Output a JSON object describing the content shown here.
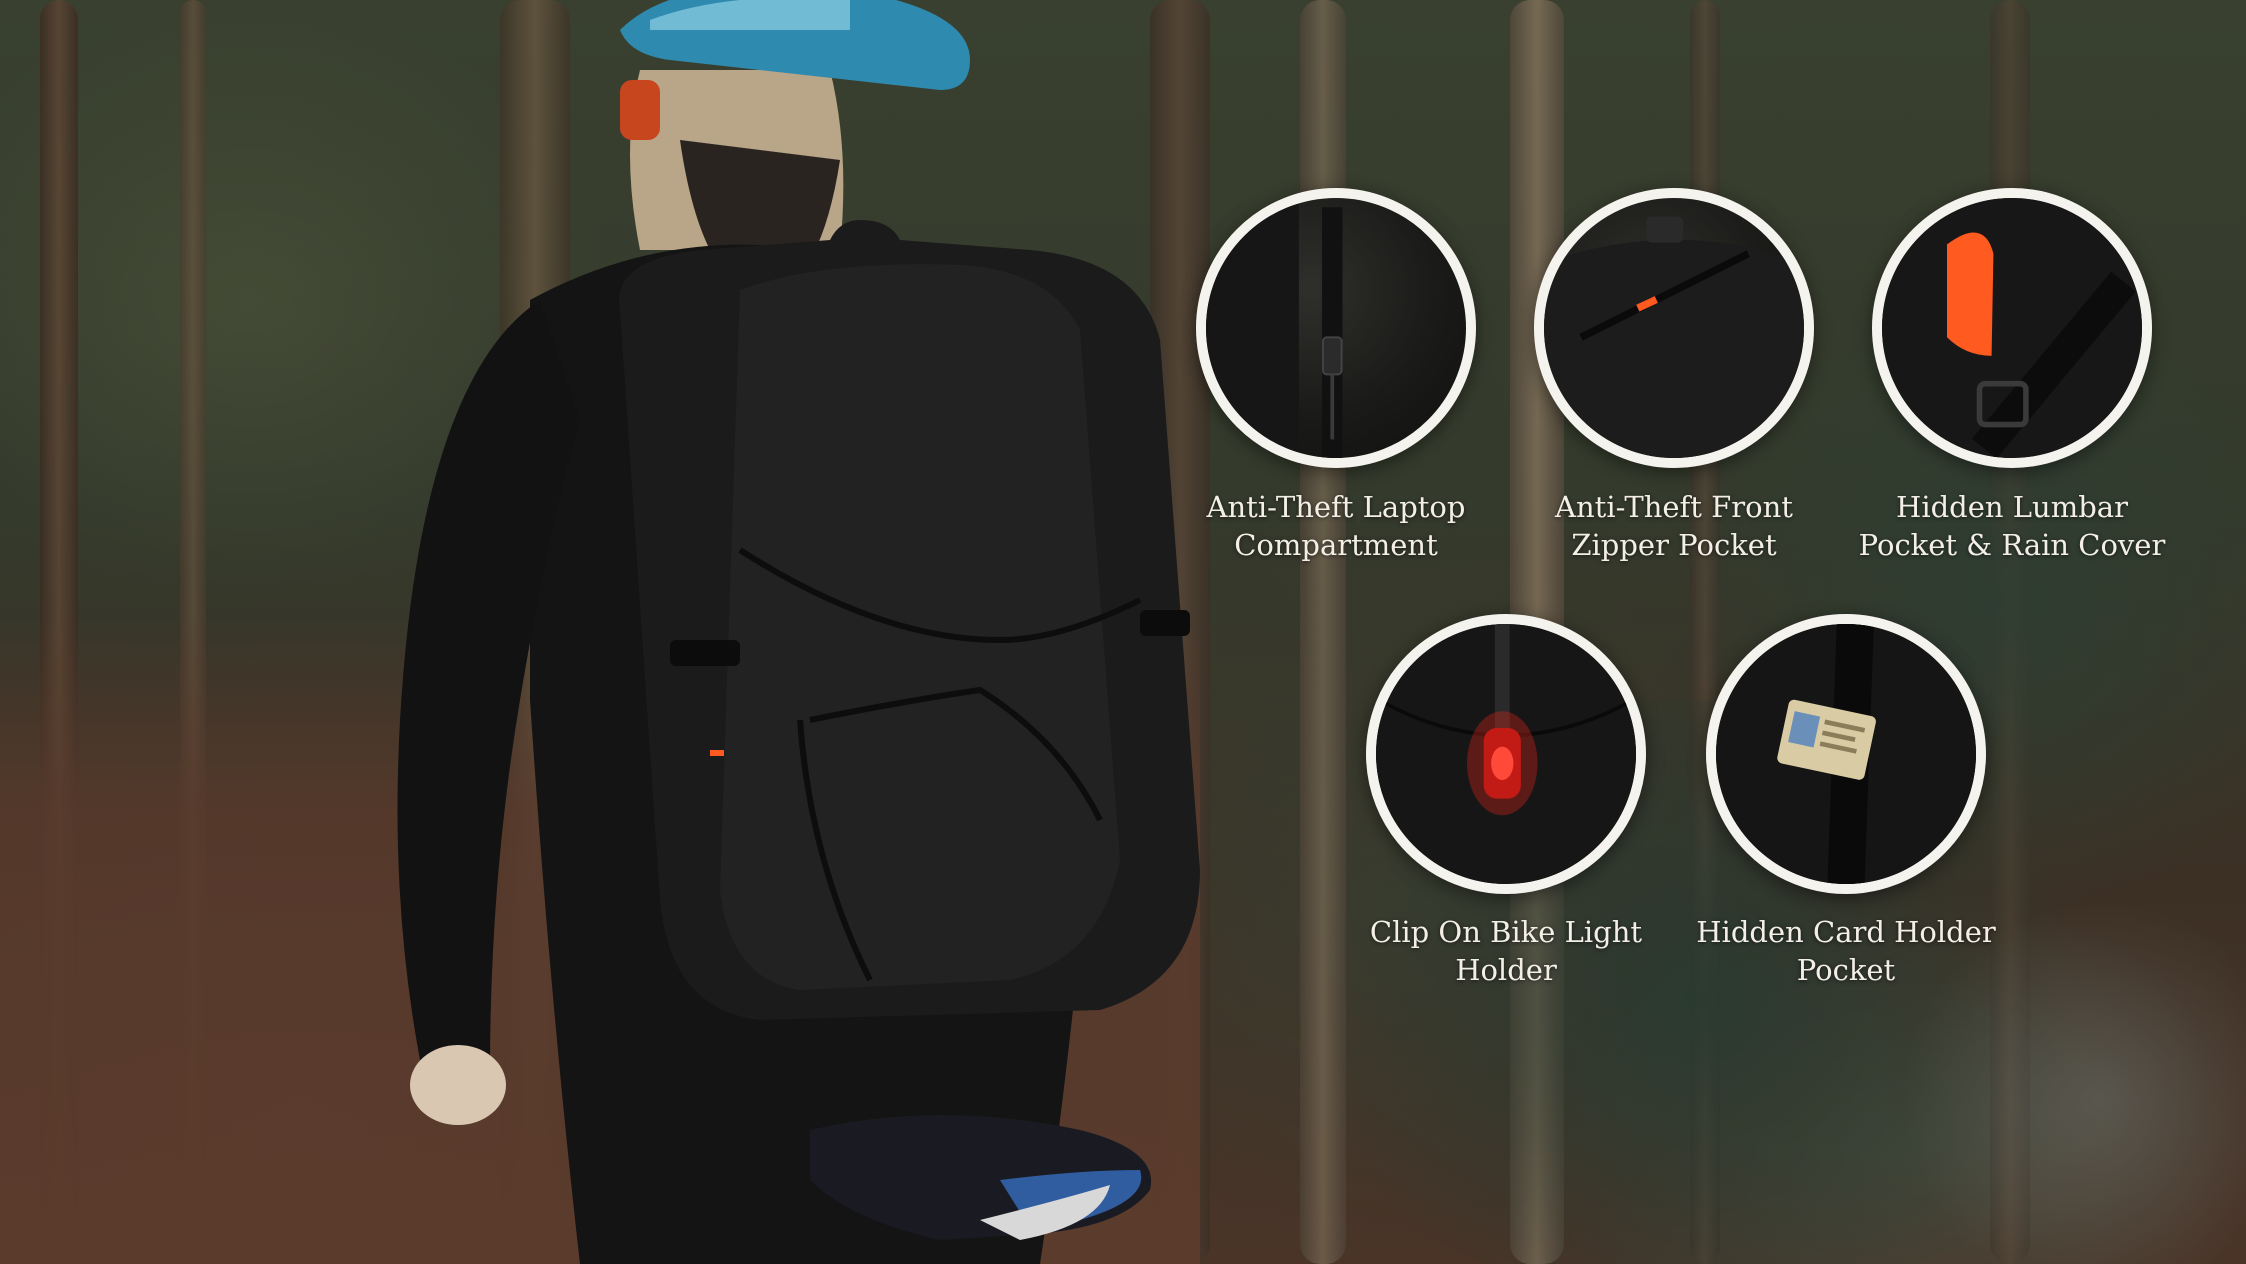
{
  "features": [
    {
      "line1": "Anti-Theft Laptop",
      "line2": "Compartment",
      "icon": "zipper-icon"
    },
    {
      "line1": "Anti-Theft Front",
      "line2": "Zipper Pocket",
      "icon": "zipper-pocket-icon"
    },
    {
      "line1": "Hidden Lumbar",
      "line2": "Pocket & Rain Cover",
      "icon": "rain-cover-icon"
    },
    {
      "line1": "Clip On Bike Light",
      "line2": "Holder",
      "icon": "bike-light-icon"
    },
    {
      "line1": "Hidden Card Holder",
      "line2": "Pocket",
      "icon": "card-holder-icon"
    }
  ],
  "colors": {
    "ring": "#f5f3ee",
    "accent_orange": "#ff5a1f",
    "light_red": "#e0241b",
    "helmet_blue": "#2f8ab0"
  }
}
